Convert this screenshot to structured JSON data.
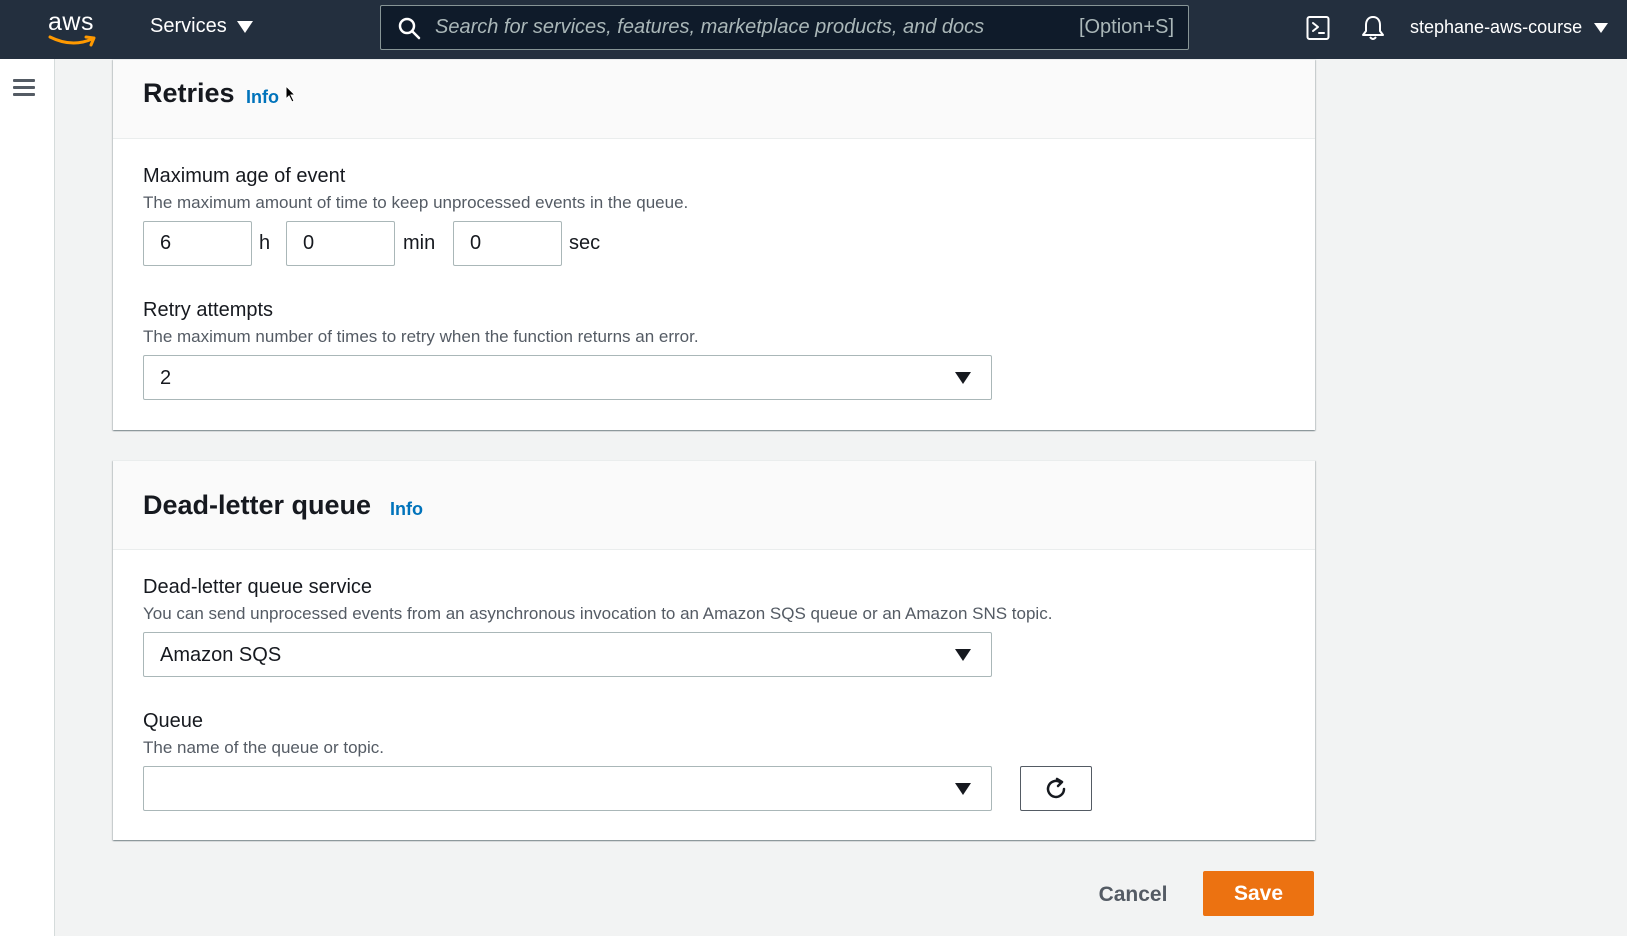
{
  "topnav": {
    "logo_text": "aws",
    "services_label": "Services",
    "search_placeholder": "Search for services, features, marketplace products, and docs",
    "search_shortcut": "[Option+S]",
    "account_name": "stephane-aws-course"
  },
  "retries": {
    "title": "Retries",
    "info_label": "Info",
    "max_age": {
      "label": "Maximum age of event",
      "description": "The maximum amount of time to keep unprocessed events in the queue.",
      "hours_value": "6",
      "hours_unit": "h",
      "minutes_value": "0",
      "minutes_unit": "min",
      "seconds_value": "0",
      "seconds_unit": "sec"
    },
    "retry_attempts": {
      "label": "Retry attempts",
      "description": "The maximum number of times to retry when the function returns an error.",
      "selected": "2"
    }
  },
  "dlq": {
    "title": "Dead-letter queue",
    "info_label": "Info",
    "service": {
      "label": "Dead-letter queue service",
      "description": "You can send unprocessed events from an asynchronous invocation to an Amazon SQS queue or an Amazon SNS topic.",
      "selected": "Amazon SQS"
    },
    "queue": {
      "label": "Queue",
      "description": "The name of the queue or topic.",
      "selected": ""
    }
  },
  "actions": {
    "cancel_label": "Cancel",
    "save_label": "Save"
  },
  "colors": {
    "nav_bg": "#232f3e",
    "link": "#0073bb",
    "primary": "#ec7211",
    "page_bg": "#f2f3f3"
  }
}
